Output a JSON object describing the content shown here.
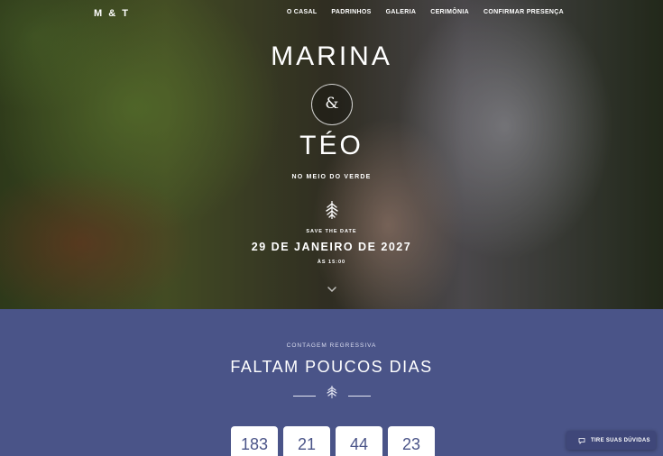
{
  "brand": "M & T",
  "nav": [
    "O CASAL",
    "PADRINHOS",
    "GALERIA",
    "CERIMÔNIA",
    "CONFIRMAR PRESENÇA"
  ],
  "hero": {
    "name1": "MARINA",
    "ampersand": "&",
    "name2": "TÉO",
    "tagline": "NO MEIO DO VERDE",
    "save_the_date": "SAVE THE DATE",
    "date": "29 DE JANEIRO DE 2027",
    "time": "ÀS 15:00"
  },
  "countdown": {
    "kicker": "CONTAGEM REGRESSIVA",
    "heading": "FALTAM POUCOS DIAS",
    "values": [
      "183",
      "21",
      "44",
      "23"
    ]
  },
  "help_button": "TIRE SUAS DÚVIDAS",
  "colors": {
    "accent": "#4a5488",
    "box": "#ffffff",
    "help_button": "#3f4779"
  },
  "icons": [
    "leaf-icon",
    "chevron-down-icon",
    "chat-icon"
  ]
}
